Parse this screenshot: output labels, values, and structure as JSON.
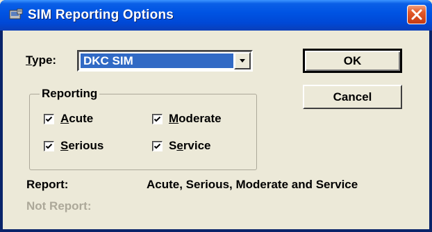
{
  "window": {
    "title": "SIM Reporting Options",
    "close_glyph": "✕"
  },
  "type_field": {
    "label": "Type:",
    "label_accel": "T",
    "label_rest": "ype:",
    "value": "DKC SIM"
  },
  "buttons": {
    "ok": "OK",
    "cancel": "Cancel"
  },
  "reporting": {
    "legend": "Reporting",
    "options": [
      {
        "label": "Acute",
        "accel": "A",
        "rest": "cute",
        "checked": true
      },
      {
        "label": "Serious",
        "accel": "S",
        "rest": "erious",
        "checked": true
      },
      {
        "label": "Moderate",
        "accel": "M",
        "rest": "oderate",
        "checked": true
      },
      {
        "label": "Service",
        "pre": "S",
        "accel": "e",
        "rest": "rvice",
        "checked": true
      }
    ]
  },
  "summary": {
    "report_label": "Report:",
    "report_value": "Acute, Serious, Moderate and Service",
    "not_report_label": "Not Report:",
    "not_report_value": ""
  },
  "colors": {
    "title_bar": "#0054e3",
    "selection": "#316ac5",
    "dialog_bg": "#ece9d8",
    "disabled_text": "#aca899"
  }
}
